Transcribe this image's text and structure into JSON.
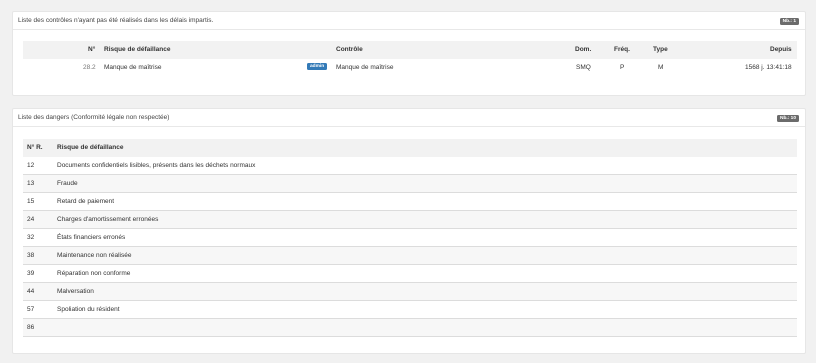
{
  "late_controls": {
    "title": "Liste des contrôles n'ayant pas été réalisés dans les délais impartis.",
    "badge": "Nb.: 1",
    "headers": {
      "num": "N°",
      "risk": "Risque de défaillance",
      "control": "Contrôle",
      "dom": "Dom.",
      "freq": "Fréq.",
      "type": "Type",
      "since": "Depuis"
    },
    "rows": [
      {
        "num": "28.2",
        "risk": "Manque de maîtrise",
        "tag": "admin",
        "control": "Manque de maîtrise",
        "dom": "SMQ",
        "freq": "P",
        "type": "M",
        "since": "1568 j. 13:41:18"
      }
    ]
  },
  "dangers": {
    "title": "Liste des dangers (Conformité légale non respectée)",
    "badge": "Nb.: 10",
    "headers": {
      "num": "N° R.",
      "risk": "Risque de défaillance"
    },
    "rows": [
      {
        "num": "12",
        "risk": "Documents confidentiels lisibles, présents dans les déchets normaux"
      },
      {
        "num": "13",
        "risk": "Fraude"
      },
      {
        "num": "15",
        "risk": "Retard de paiement"
      },
      {
        "num": "24",
        "risk": "Charges d'amortissement erronées"
      },
      {
        "num": "32",
        "risk": "États financiers erronés"
      },
      {
        "num": "38",
        "risk": "Maintenance non réalisée"
      },
      {
        "num": "39",
        "risk": "Réparation non conforme"
      },
      {
        "num": "44",
        "risk": "Malversation"
      },
      {
        "num": "57",
        "risk": "Spoliation du résident"
      },
      {
        "num": "86",
        "risk": ""
      }
    ]
  }
}
